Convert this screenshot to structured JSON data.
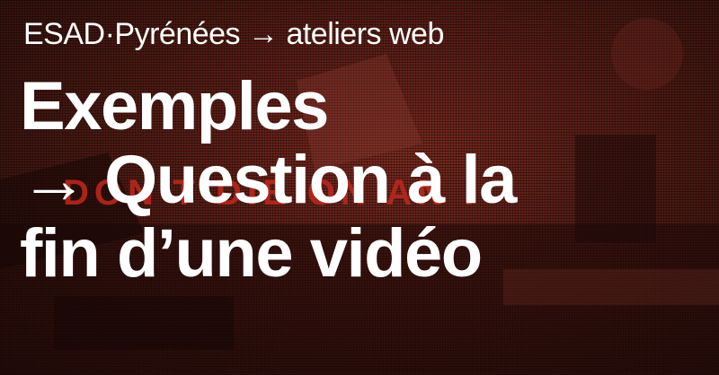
{
  "header": {
    "kicker": "ESAD·Pyrénées → ateliers web"
  },
  "main": {
    "title_lines": [
      "Exemples",
      "→ Question à la",
      "fin d’une vidéo"
    ]
  },
  "background": {
    "sign_text": "DON'T DIE ON AN I",
    "base_color": "#3a1410",
    "accent_color": "#c0281e"
  }
}
